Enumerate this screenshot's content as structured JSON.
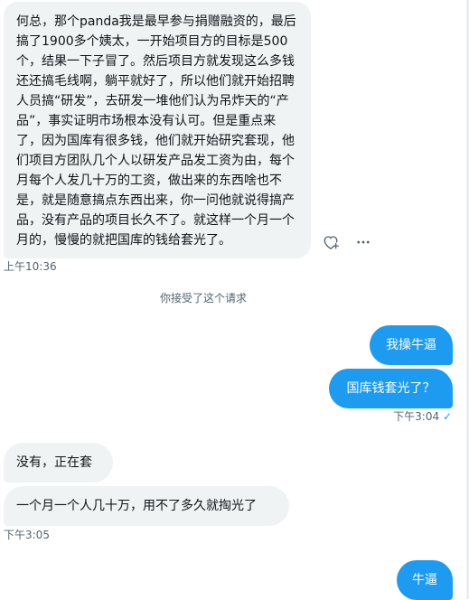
{
  "messages": [
    {
      "text": "何总，那个panda我是最早参与捐赠融资的，最后搞了1900多个姨太，一开始项目方的目标是500个，结果一下子冒了。然后项目方就发现这么多钱还还搞毛线啊，躺平就好了，所以他们就开始招聘人员搞“研发”，去研发一堆他们认为吊炸天的“产品”，事实证明市场根本没有认可。但是重点来了，因为国库有很多钱，他们就开始研究套现，他们项目方团队几个人以研发产品发工资为由，每个月每个人发几十万的工资，做出来的东西啥也不是，就是随意搞点东西出来，你一问他就说得搞产品，没有产品的项目长久不了。就这样一个月一个月的，慢慢的就把国库的钱给套光了。",
      "time": "上午10:36"
    },
    {
      "system": "你接受了这个请求"
    },
    {
      "text": "我操牛逼"
    },
    {
      "text": "国库钱套光了？",
      "time": "下午3:04",
      "status": "✓"
    },
    {
      "text": "没有，正在套"
    },
    {
      "text": "一个月一个人几十万，用不了多久就掏光了",
      "time": "下午3:05"
    },
    {
      "text": "牛逼"
    }
  ],
  "icons": {
    "react": "heart-plus-icon",
    "more": "more-icon"
  },
  "colors": {
    "outgoing_bubble": "#1d9bf0",
    "incoming_bubble": "#eff3f4",
    "timestamp": "#536471"
  }
}
